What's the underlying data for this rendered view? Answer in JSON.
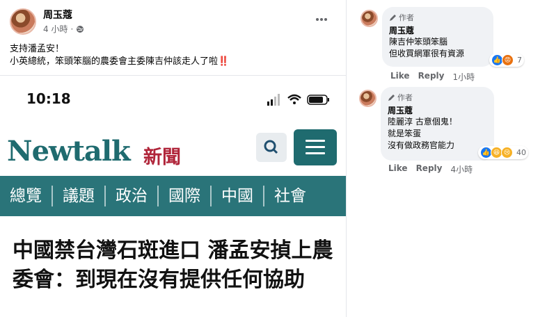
{
  "post": {
    "author": "周玉蔻",
    "time": "4 小時",
    "text_line1": "支持潘孟安！",
    "text_line2": "小英總統，笨頭笨腦的農委會主委陳吉仲該走人了啦",
    "emoji": "‼️"
  },
  "article": {
    "phone_time": "10:18",
    "logo": "Newtalk",
    "logo_cn": "新聞",
    "nav": [
      "總覽",
      "議題",
      "政治",
      "國際",
      "中國",
      "社會"
    ],
    "headline": "中國禁台灣石斑進口 潘孟安揁上農委會：到現在沒有提供任何協助"
  },
  "comments": [
    {
      "badge": "作者",
      "name": "周玉蔻",
      "lines": [
        "陳吉仲笨頭笨腦",
        "但收買網軍很有資源"
      ],
      "reaction_count": "7",
      "like": "Like",
      "reply": "Reply",
      "time": "1小時"
    },
    {
      "badge": "作者",
      "name": "周玉蔻",
      "lines": [
        "陸麗淳 古意個鬼！",
        "就是笨蛋",
        "沒有做政務官能力"
      ],
      "reaction_count": "40",
      "like": "Like",
      "reply": "Reply",
      "time": "4小時"
    }
  ],
  "colors": {
    "newtalk_teal": "#2a7479",
    "newtalk_red": "#b0253a",
    "fb_like_blue": "#1877f2",
    "angry_orange": "#e9710f"
  }
}
